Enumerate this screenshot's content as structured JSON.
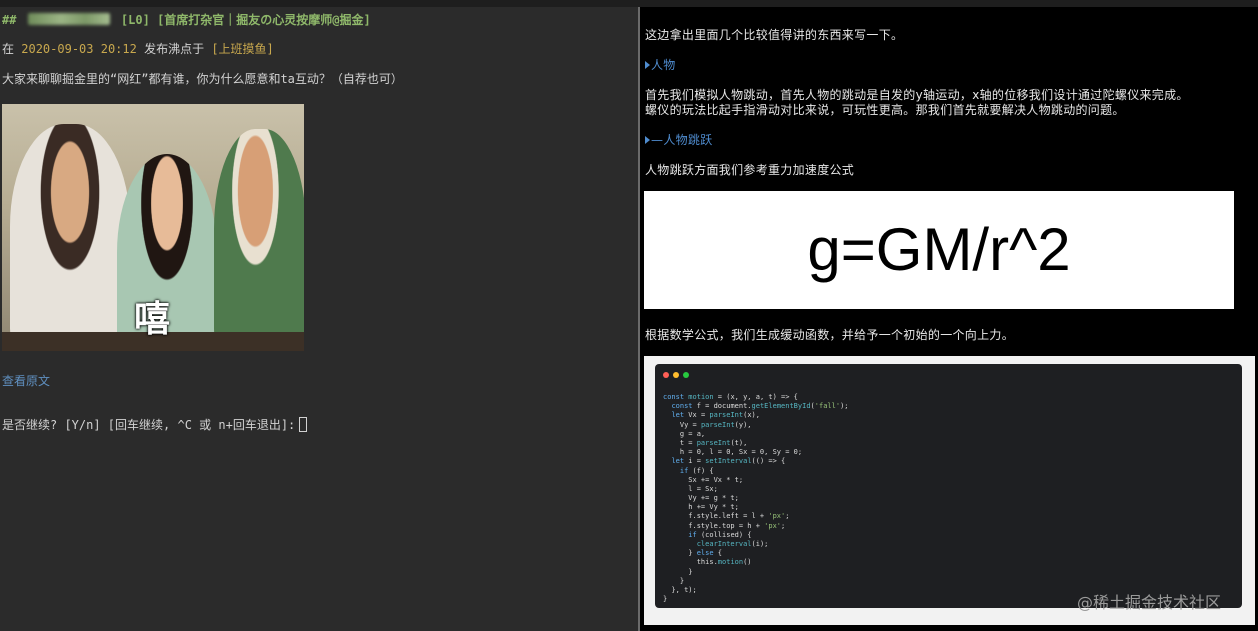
{
  "left": {
    "title_hash": "##",
    "title_level": "[L0]",
    "title_tags": "[首席打杂官｜掘友の心灵按摩师@掘金]",
    "meta_prefix": "在",
    "meta_datetime": "2020-09-03 20:12",
    "meta_middle": "发布沸点于",
    "meta_topic": "[上班摸鱼]",
    "question": "大家来聊聊掘金里的“网红”都有谁，你为什么愿意和ta互动？（自荐也可）",
    "image_caption": "嘻",
    "view_original": "查看原文",
    "prompt": "是否继续? [Y/n] [回车继续, ^C 或 n+回车退出]:"
  },
  "right": {
    "intro": "这边拿出里面几个比较值得讲的东西来写一下。",
    "heading1": "人物",
    "para1_line1": "首先我们模拟人物跳动，首先人物的跳动是自发的y轴运动，x轴的位移我们设计通过陀螺仪来完成。",
    "para1_line2": "螺仪的玩法比起手指滑动对比来说，可玩性更高。那我们首先就要解决人物跳动的问题。",
    "heading2_prefix": "—",
    "heading2": "人物跳跃",
    "para2": "人物跳跃方面我们参考重力加速度公式",
    "formula": "g=GM/r^2",
    "para3": "根据数学公式，我们生成缓动函数，并给予一个初始的一个向上力。",
    "code_lines": [
      "const motion = (x, y, a, t) => {",
      "  const f = document.getElementById('fall');",
      "  let Vx = parseInt(x),",
      "    Vy = parseInt(y),",
      "    g = a,",
      "    t = parseInt(t),",
      "    h = 0, l = 0, Sx = 0, Sy = 0;",
      "  let i = setInterval(() => {",
      "    if (f) {",
      "      Sx += Vx * t;",
      "      l = Sx;",
      "      Vy += g * t;",
      "      h += Vy * t;",
      "      f.style.left = l + 'px';",
      "      f.style.top = h + 'px';",
      "      if (collised) {",
      "        clearInterval(i);",
      "      } else {",
      "        this.motion()",
      "      }",
      "    }",
      "  }, t);",
      "}"
    ],
    "watermark": "@稀土掘金技术社区"
  },
  "colors": {
    "terminal_bg": "#2b2b2b",
    "title_green": "#8fb86a",
    "meta_yellow": "#c8a84e",
    "link_blue": "#5f8fbf",
    "heading_blue": "#4f8ccf"
  }
}
